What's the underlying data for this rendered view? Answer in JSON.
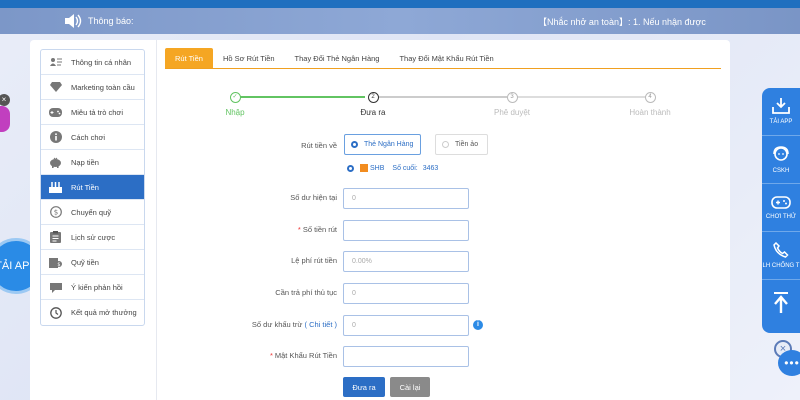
{
  "notice": {
    "label": "Thông báo:",
    "message": "【Nhắc nhở an toàn】:   1. Nếu nhận được"
  },
  "sidebar": {
    "items": [
      {
        "label": "Thông tin cá nhân",
        "icon": "id-card-icon"
      },
      {
        "label": "Marketing toàn cầu",
        "icon": "diamond-icon"
      },
      {
        "label": "Miêu tả trò chơi",
        "icon": "gamepad-icon"
      },
      {
        "label": "Cách chơi",
        "icon": "info-icon"
      },
      {
        "label": "Nạp tiền",
        "icon": "piggy-bank-icon"
      },
      {
        "label": "Rút Tiền",
        "icon": "withdraw-icon",
        "active": true
      },
      {
        "label": "Chuyển quỹ",
        "icon": "coin-transfer-icon"
      },
      {
        "label": "Lịch sử cược",
        "icon": "clipboard-icon"
      },
      {
        "label": "Quỹ tiền",
        "icon": "wallet-icon"
      },
      {
        "label": "Ý kiến phản hồi",
        "icon": "chat-icon"
      },
      {
        "label": "Kết quả mở thưởng",
        "icon": "history-icon"
      }
    ]
  },
  "tabs": [
    "Rút Tiền",
    "Hồ Sơ Rút Tiền",
    "Thay Đổi Thẻ Ngân Hàng",
    "Thay Đổi Mật Khẩu Rút Tiền"
  ],
  "steps": [
    {
      "num": "✓",
      "label": "Nhập",
      "state": "done"
    },
    {
      "num": "2",
      "label": "Đưa ra",
      "state": "current"
    },
    {
      "num": "3",
      "label": "Phê duyệt",
      "state": "pending"
    },
    {
      "num": "4",
      "label": "Hoàn thành",
      "state": "pending"
    }
  ],
  "form": {
    "withdraw_to_label": "Rút tiền về",
    "option_bank": "Thẻ Ngân Hàng",
    "option_virtual": "Tiền ảo",
    "bank_name": "SHB",
    "card_suffix_label": "Số cuối:",
    "card_suffix": "3463",
    "balance_label": "Số dư hiện tại",
    "balance_value": "0",
    "amount_label": "Số tiền rút",
    "fee_label": "Lệ phí rút tiền",
    "fee_value": "0.00%",
    "procedure_fee_label": "Cần trả phí thủ tục",
    "procedure_fee_value": "0",
    "deduct_label": "Số dư khấu trừ",
    "deduct_detail": "( Chi tiết )",
    "deduct_value": "0",
    "password_label": "Mật Khẩu Rút Tiền",
    "submit_label": "Đưa ra",
    "reset_label": "Cài lại"
  },
  "rightbar": [
    {
      "label": "TẢI APP",
      "icon": "download-icon"
    },
    {
      "label": "CSKH",
      "icon": "support-agent-icon"
    },
    {
      "label": "CHƠI THỬ",
      "icon": "gamepad-icon"
    },
    {
      "label": "LH CHỐNG T",
      "icon": "phone-icon"
    },
    {
      "label": "",
      "icon": "arrow-up-icon"
    }
  ],
  "left_float": {
    "label": "TẢI APP"
  },
  "colors": {
    "accent_blue": "#2c6ec5",
    "tab_orange": "#f5a623",
    "success_green": "#62c462"
  }
}
